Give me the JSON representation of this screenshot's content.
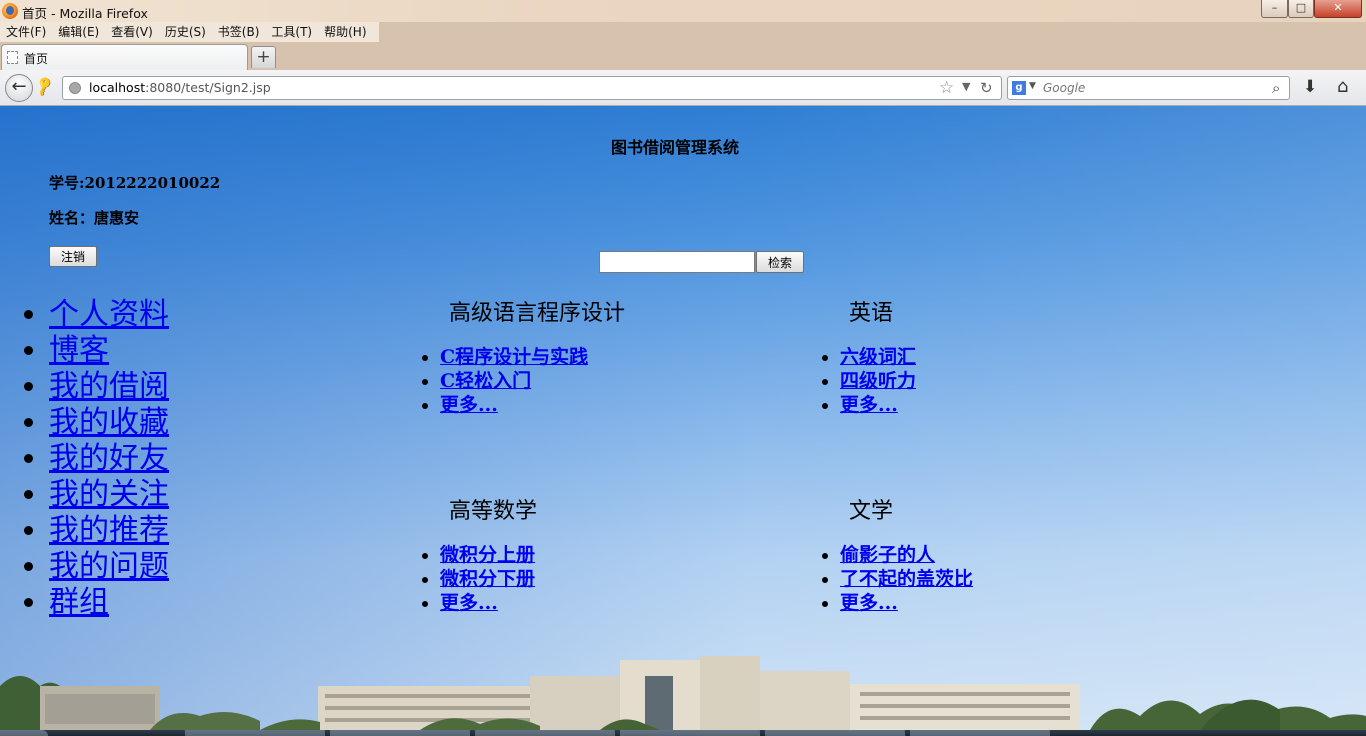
{
  "window": {
    "title": "首页 - Mozilla Firefox",
    "controls": {
      "minimize": "–",
      "maximize": "□",
      "close": "✕"
    }
  },
  "menubar": {
    "items": [
      "文件(F)",
      "编辑(E)",
      "查看(V)",
      "历史(S)",
      "书签(B)",
      "工具(T)",
      "帮助(H)"
    ]
  },
  "tabs": [
    {
      "label": "首页",
      "active": true
    }
  ],
  "newtab_label": "+",
  "navbar": {
    "url_host": "localhost",
    "url_rest": ":8080/test/Sign2.jsp",
    "search_placeholder": "Google",
    "search_engine_icon": "google-icon"
  },
  "page": {
    "title": "图书借阅管理系统",
    "student_id": "学号:2012222010022",
    "student_name": "姓名：唐惠安",
    "logout_label": "注销",
    "search_value": "",
    "search_button_label": "检索",
    "side_menu": [
      "个人资料",
      "博客",
      "我的借阅",
      "我的收藏",
      "我的好友",
      "我的关注",
      "我的推荐",
      "我的问题",
      "群组"
    ],
    "categories": [
      {
        "title": "高级语言程序设计",
        "links": [
          "C程序设计与实践",
          "C轻松入门",
          "更多..."
        ]
      },
      {
        "title": "英语",
        "links": [
          "六级词汇",
          "四级听力",
          "更多..."
        ]
      },
      {
        "title": "高等数学",
        "links": [
          "微积分上册",
          "微积分下册",
          "更多..."
        ]
      },
      {
        "title": "文学",
        "links": [
          "偷影子的人",
          "了不起的盖茨比",
          "更多..."
        ]
      }
    ]
  },
  "colors": {
    "link": "#0000ee",
    "sky_top": "#2f7ed4",
    "sky_bottom": "#cfe2f5",
    "titlebar": "#ead6c1"
  }
}
